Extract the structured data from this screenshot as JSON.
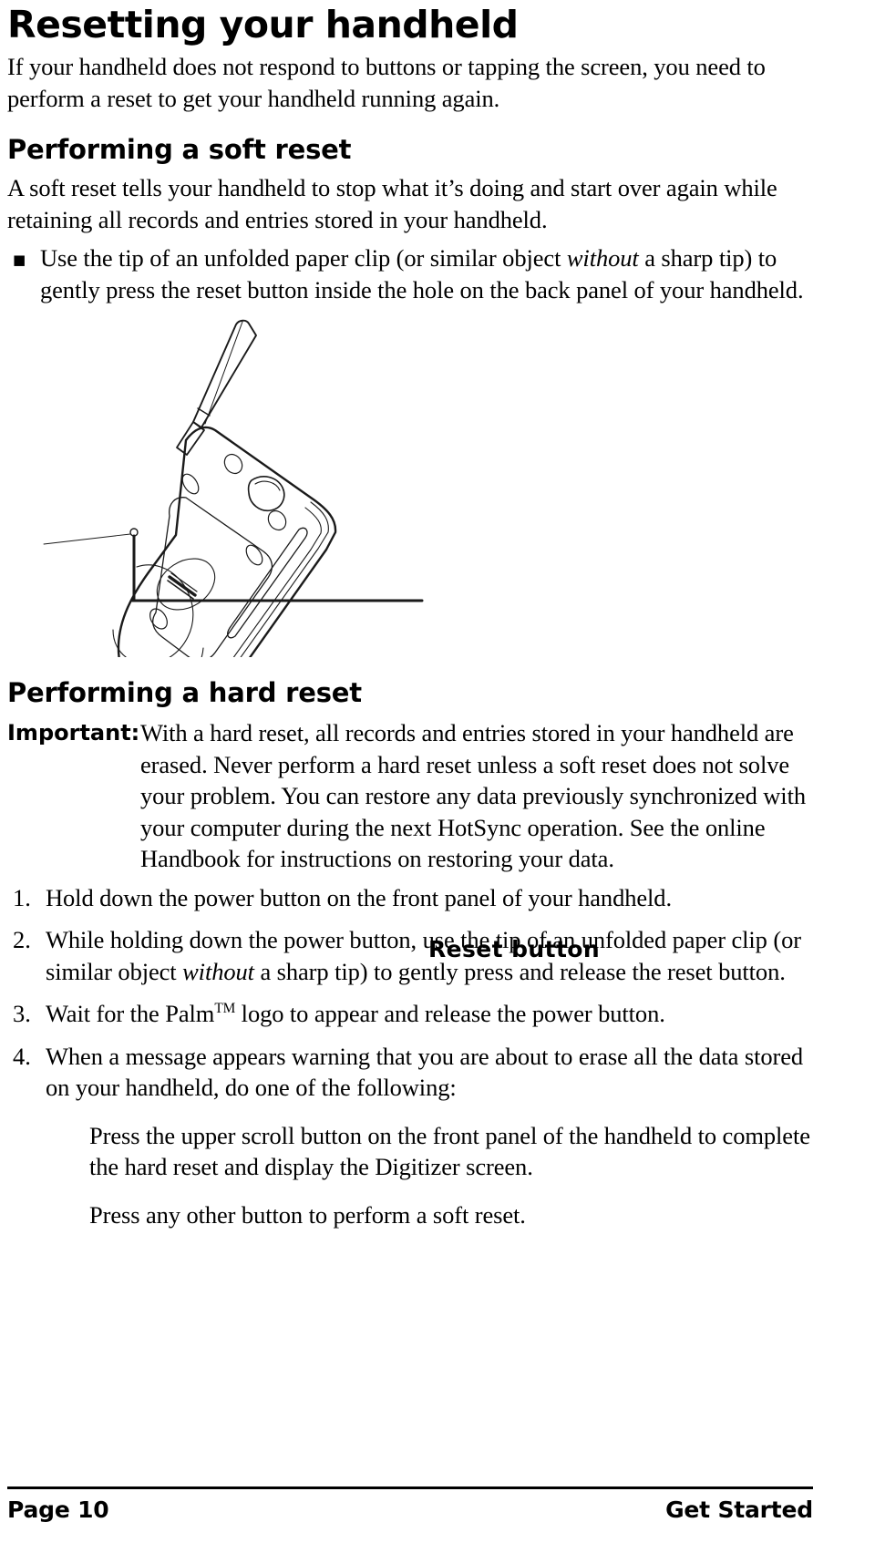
{
  "document": {
    "title": "Resetting your handheld",
    "intro": "If your handheld does not respond to buttons or tapping the screen, you need to perform a reset to get your handheld running again."
  },
  "soft_reset": {
    "heading": "Performing a soft reset",
    "paragraph": "A soft reset tells your handheld to stop what it’s doing and start over again while retaining all records and entries stored in your handheld.",
    "bullet_marker": "■",
    "bullet_part1": "Use the tip of an unfolded paper clip (or similar object ",
    "bullet_italic": "without",
    "bullet_part2": " a sharp tip) to gently press the reset button inside the hole on the back panel of your handheld."
  },
  "figure": {
    "name": "handheld-back-panel-illustration",
    "callout_label": "Reset button"
  },
  "hard_reset": {
    "heading": "Performing a hard reset",
    "important_label": "Important:",
    "important_text": "With a hard reset, all records and entries stored in your handheld are erased. Never perform a hard reset unless a soft reset does not solve your problem. You can restore any data previously synchronized with your computer during the next HotSync operation. See the online Handbook for instructions on restoring your data.",
    "steps": [
      {
        "number": "1.",
        "part1": "Hold down the power button on the front panel of your handheld.",
        "italic": "",
        "part2": ""
      },
      {
        "number": "2.",
        "part1": "While holding down the power button, use the tip of an unfolded paper clip (or similar object ",
        "italic": "without",
        "part2": " a sharp tip) to gently press and release the reset button."
      },
      {
        "number": "3.",
        "part1": "Wait for the Palm",
        "italic": "",
        "part2": " logo to appear and release the power button.",
        "trademark": "TM"
      },
      {
        "number": "4.",
        "part1": "When a message appears warning that you are about to erase all the data stored on your handheld, do one of the following:",
        "italic": "",
        "part2": ""
      }
    ],
    "sub_paragraphs": [
      "Press the upper scroll button on the front panel of the handheld to complete the hard reset and display the Digitizer screen.",
      "Press any other button to perform a soft reset."
    ]
  },
  "footer": {
    "page_label": "Page 10",
    "section_label": "Get Started"
  },
  "colors": {
    "text": "#000000",
    "background": "#ffffff",
    "line_art": "#1a1a1a"
  }
}
